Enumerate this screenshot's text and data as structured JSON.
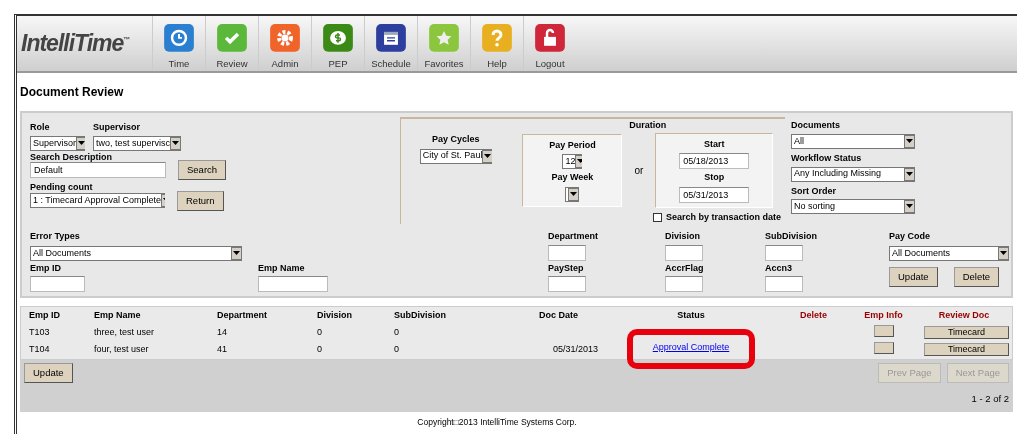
{
  "logo": {
    "name": "IntelliTime",
    "mark": "™"
  },
  "nav": [
    {
      "label": "Time",
      "kind": "clock"
    },
    {
      "label": "Review",
      "kind": "check"
    },
    {
      "label": "Admin",
      "kind": "gear"
    },
    {
      "label": "PEP",
      "kind": "dollar"
    },
    {
      "label": "Schedule",
      "kind": "calendar"
    },
    {
      "label": "Favorites",
      "kind": "star"
    },
    {
      "label": "Help",
      "kind": "help"
    },
    {
      "label": "Logout",
      "kind": "lock"
    }
  ],
  "page_title": "Document Review",
  "filters": {
    "role": {
      "label": "Role",
      "value": "Supervisor"
    },
    "supervisor": {
      "label": "Supervisor",
      "value": "two, test supervisc"
    },
    "search_description": {
      "label": "Search Description",
      "value": "Default"
    },
    "search_button": "Search",
    "pending_count": {
      "label": "Pending count",
      "value": "1 : Timecard Approval Complete"
    },
    "return_button": "Return",
    "pay_cycles": {
      "label": "Pay Cycles",
      "value": "City of St. Paul"
    },
    "duration": {
      "title": "Duration",
      "pay_period_label": "Pay Period",
      "pay_period": "12",
      "pay_week_label": "Pay Week",
      "or": "or",
      "start_label": "Start",
      "start": "05/18/2013",
      "stop_label": "Stop",
      "stop": "05/31/2013"
    },
    "transaction_date": {
      "label": "Search by transaction date",
      "checked": false
    },
    "documents": {
      "label": "Documents",
      "value": "All"
    },
    "workflow_status": {
      "label": "Workflow Status",
      "value": "Any Including Missing"
    },
    "sort_order": {
      "label": "Sort Order",
      "value": "No sorting"
    },
    "error_types": {
      "label": "Error Types",
      "value": "All Documents"
    },
    "emp_id_label": "Emp ID",
    "emp_name_label": "Emp Name",
    "text_fields": [
      {
        "label": "Department"
      },
      {
        "label": "Division"
      },
      {
        "label": "SubDivision"
      },
      {
        "label": "PayStep"
      },
      {
        "label": "AccrFlag"
      },
      {
        "label": "Accn3"
      }
    ],
    "pay_code": {
      "label": "Pay Code",
      "value": "All Documents"
    },
    "update_button": "Update",
    "delete_button": "Delete"
  },
  "table": {
    "columns": [
      "Emp ID",
      "Emp Name",
      "Department",
      "Division",
      "SubDivision",
      "Doc Date",
      "Status",
      "Delete",
      "Emp Info",
      "Review Doc"
    ],
    "rows": [
      {
        "emp_id": "T103",
        "emp_name": "three, test user",
        "department": "14",
        "division": "0",
        "subdivision": "0",
        "review_doc": "Timecard"
      },
      {
        "emp_id": "T104",
        "emp_name": "four, test user",
        "department": "41",
        "division": "0",
        "subdivision": "0",
        "doc_date": "05/31/2013",
        "status": "Approval Complete",
        "review_doc": "Timecard"
      }
    ]
  },
  "update_button": "Update",
  "pager": {
    "prev": {
      "label": "Prev Page",
      "disabled": true
    },
    "next": {
      "label": "Next Page",
      "disabled": true
    },
    "count": "1 - 2 of 2"
  },
  "copyright": "Copyright□2013 IntelliTime Systems Corp."
}
